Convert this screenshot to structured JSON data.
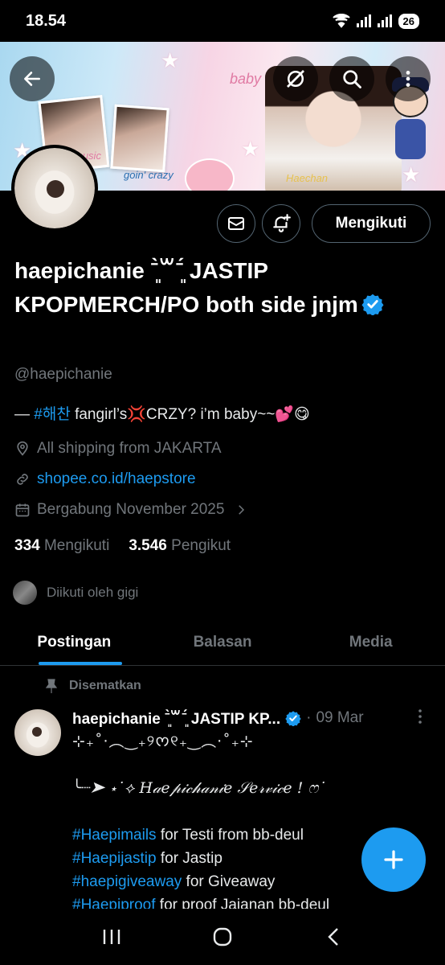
{
  "status": {
    "time": "18.54",
    "battery": "26"
  },
  "banner": {
    "sticker_baby": "baby",
    "sticker_name": "Haechan",
    "sticker_crazy": "goin' crazy",
    "sticker_music": "music"
  },
  "profile": {
    "name": "haepichanie ˉ͈̀꒳ˉ͈́ JASTIP KPOPMERCH/PO both side jnjm",
    "handle": "@haepichanie",
    "bio_prefix": "— ",
    "bio_tag": "#해찬",
    "bio_rest": " fangirl’s💢CRZY? i’m baby~~💕😋",
    "location": "All shipping from JAKARTA",
    "website": "shopee.co.id/haepstore",
    "joined": "Bergabung November 2025",
    "following_count": "334",
    "following_label": "Mengikuti",
    "followers_count": "3.546",
    "followers_label": "Pengikut",
    "followed_by": "Diikuti oleh gigi",
    "follow_button": "Mengikuti"
  },
  "tabs": [
    "Postingan",
    "Balasan",
    "Media"
  ],
  "post": {
    "pinned_label": "Disematkan",
    "author": "haepichanie ˉ͈̀꒳ˉ͈́ JASTIP KP...",
    "dot": "·",
    "date": "09 Mar",
    "line1": "⊹₊˚‧︵‿₊୨ᰔ୧₊‿︵‧˚₊⊹",
    "line2": "╰┈➤ ⋆˙⟡ 𝐻𝒶𝑒𝓅𝒾𝒸𝒽𝒶𝓃𝒾𝑒 𝒮𝑒𝓇𝓋𝒾𝒸𝑒 ! ෆ˙",
    "tags": [
      {
        "tag": "#Haepimails",
        "text": " for Testi from bb-deul"
      },
      {
        "tag": "#Haepijastip",
        "text": " for Jastip"
      },
      {
        "tag": "#haepigiveaway",
        "text": " for Giveaway"
      },
      {
        "tag": "#Haepiproof",
        "text": " for proof Jajanan bb-deul"
      }
    ]
  },
  "icons": {
    "back": "arrow-left-icon",
    "grok": "grok-icon",
    "search": "search-icon",
    "message": "envelope-icon",
    "notify": "bell-plus-icon",
    "location": "location-pin-icon",
    "link": "link-icon",
    "calendar": "calendar-icon",
    "pin": "pin-icon",
    "compose": "plus-icon"
  },
  "colors": {
    "accent": "#1d9bf0",
    "muted": "#71767b",
    "background": "#000000"
  }
}
